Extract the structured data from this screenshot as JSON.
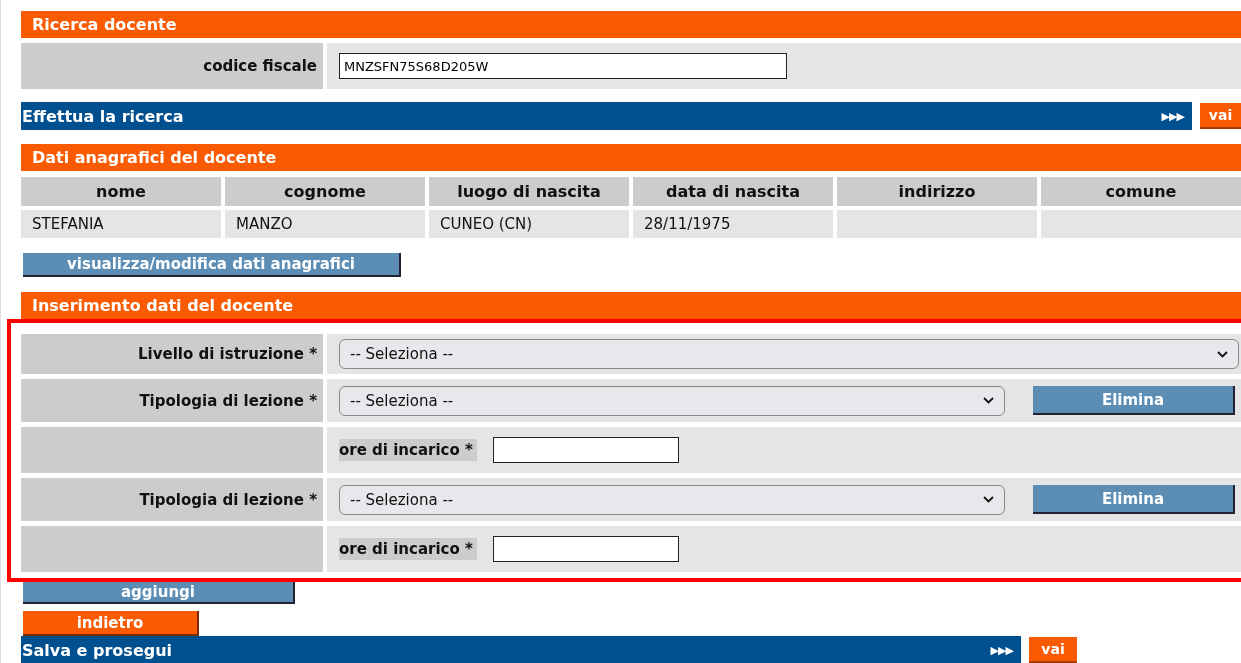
{
  "search_section": {
    "title": "Ricerca docente",
    "fields": [
      {
        "label": "codice fiscale",
        "value": "MNZSFN75S68D205W"
      }
    ]
  },
  "search_bar": {
    "label": "Effettua la ricerca",
    "arrows": "▶▶▶",
    "button": "vai"
  },
  "personal_section": {
    "title": "Dati anagrafici del docente",
    "columns": [
      "nome",
      "cognome",
      "luogo di nascita",
      "data di nascita",
      "indirizzo",
      "comune"
    ],
    "rows": [
      [
        "STEFANIA",
        "MANZO",
        "CUNEO (CN)",
        "28/11/1975",
        "",
        ""
      ]
    ],
    "button": "visualizza/modifica dati anagrafici"
  },
  "entry_section": {
    "title": "Inserimento dati del docente",
    "highlighted": true,
    "rows": [
      {
        "kind": "select",
        "label": "Livello di istruzione *",
        "value": "-- Seleziona --"
      },
      {
        "kind": "select",
        "label": "Tipologia di lezione *",
        "value": "-- Seleziona --",
        "button": "Elimina"
      },
      {
        "kind": "hours",
        "label": "ore di incarico *",
        "value": ""
      },
      {
        "kind": "select",
        "label": "Tipologia di lezione *",
        "value": "-- Seleziona --",
        "button": "Elimina"
      },
      {
        "kind": "hours",
        "label": "ore di incarico *",
        "value": ""
      }
    ]
  },
  "add_button": "aggiungi",
  "back_button": "indietro",
  "save_bar": {
    "label": "Salva e prosegui",
    "arrows": "▶▶▶",
    "button": "vai"
  }
}
